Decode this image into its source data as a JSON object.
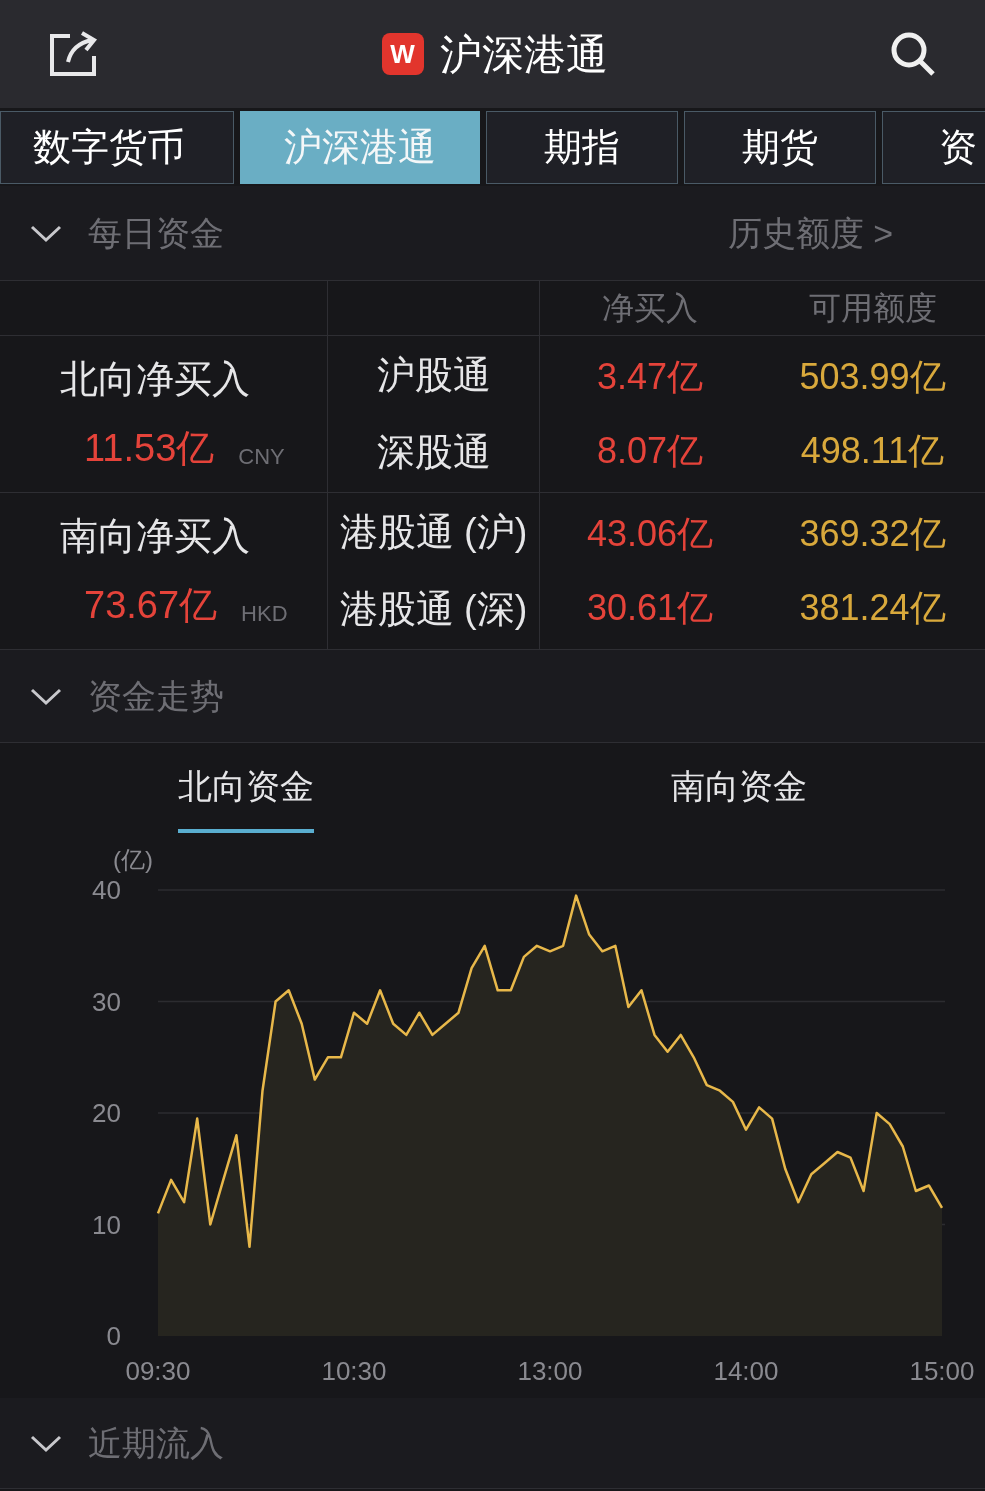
{
  "header": {
    "logo_letter": "W",
    "title": "沪深港通"
  },
  "tabs": [
    {
      "label": "数字货币",
      "selected": false
    },
    {
      "label": "沪深港通",
      "selected": true
    },
    {
      "label": "期指",
      "selected": false
    },
    {
      "label": "期货",
      "selected": false
    },
    {
      "label": "资",
      "selected": false
    }
  ],
  "daily_section": {
    "title": "每日资金",
    "expanded": true,
    "link": "历史额度 >"
  },
  "flow_table": {
    "columns": [
      "净买入",
      "可用额度"
    ],
    "groups": [
      {
        "label": "北向净买入",
        "total": "11.53亿",
        "currency": "CNY",
        "rows": [
          {
            "name": "沪股通",
            "net_buy": "3.47亿",
            "quota": "503.99亿"
          },
          {
            "name": "深股通",
            "net_buy": "8.07亿",
            "quota": "498.11亿"
          }
        ]
      },
      {
        "label": "南向净买入",
        "total": "73.67亿",
        "currency": "HKD",
        "rows": [
          {
            "name": "港股通 (沪)",
            "net_buy": "43.06亿",
            "quota": "369.32亿"
          },
          {
            "name": "港股通 (深)",
            "net_buy": "30.61亿",
            "quota": "381.24亿"
          }
        ]
      }
    ]
  },
  "trend_section": {
    "title": "资金走势",
    "expanded": true,
    "chart_tabs": [
      {
        "label": "北向资金",
        "selected": true
      },
      {
        "label": "南向资金",
        "selected": false
      }
    ],
    "chart_data": {
      "type": "area",
      "ylabel": "(亿)",
      "categories": [
        "09:30",
        null,
        null,
        null,
        null,
        null,
        null,
        null,
        null,
        null,
        null,
        null,
        null,
        null,
        null,
        "10:30",
        null,
        null,
        null,
        null,
        null,
        null,
        null,
        null,
        null,
        null,
        null,
        null,
        null,
        null,
        "13:00",
        null,
        null,
        null,
        null,
        null,
        null,
        null,
        null,
        null,
        null,
        null,
        null,
        null,
        null,
        "14:00",
        null,
        null,
        null,
        null,
        null,
        null,
        null,
        null,
        null,
        null,
        null,
        null,
        null,
        null,
        "15:00"
      ],
      "series": [
        {
          "color": "#e8b84a",
          "values": [
            11,
            14,
            12,
            19.5,
            10,
            14,
            18,
            8,
            22,
            30,
            31,
            28,
            23,
            25,
            25,
            29,
            28,
            31,
            28,
            27,
            29,
            27,
            28,
            29,
            33,
            35,
            31,
            31,
            34,
            35,
            34.5,
            35,
            39.5,
            36,
            34.5,
            35,
            29.5,
            31,
            27,
            25.5,
            27,
            25,
            22.5,
            22,
            21,
            18.5,
            20.5,
            19.5,
            15,
            12,
            14.5,
            15.5,
            16.5,
            16,
            13,
            20,
            19,
            17,
            13,
            13.5,
            11.5
          ]
        }
      ],
      "ylim": [
        0,
        40
      ],
      "grid": true,
      "yticks": [
        0,
        10,
        20,
        30,
        40
      ]
    }
  },
  "recent_section": {
    "title": "近期流入",
    "expanded": true
  }
}
